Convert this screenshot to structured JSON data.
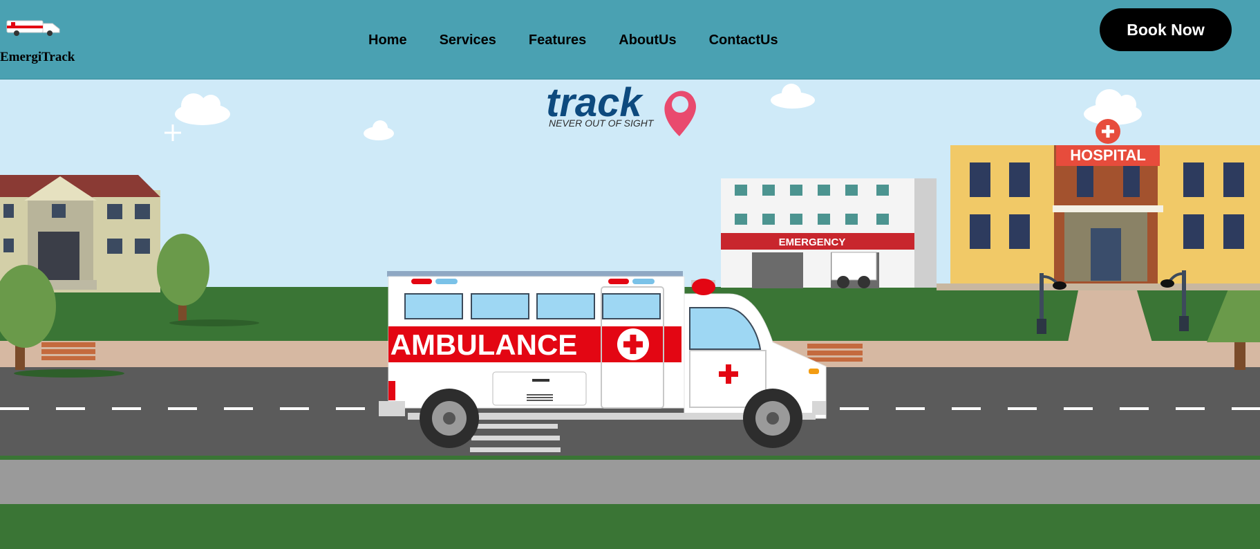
{
  "brand": {
    "name": "EmergiTrack",
    "icon": "ambulance-icon"
  },
  "nav": {
    "items": [
      {
        "label": "Home"
      },
      {
        "label": "Services"
      },
      {
        "label": "Features"
      },
      {
        "label": "AboutUs"
      },
      {
        "label": "ContactUs"
      }
    ],
    "cta_label": "Book Now"
  },
  "hero": {
    "logo_word": "track",
    "logo_tagline": "NEVER OUT OF SIGHT",
    "hospital_sign": "HOSPITAL",
    "emergency_sign": "EMERGENCY",
    "ambulance_text": "AMBULANCE"
  },
  "colors": {
    "header_bg": "#4aa1b2",
    "cta_bg": "#000000",
    "sky": "#cfeaf8",
    "grass": "#3a7535",
    "road": "#5b5b5b",
    "ambulance_red": "#e30613",
    "logo_blue": "#0d4a7e",
    "pin_pink": "#e94a6e"
  }
}
